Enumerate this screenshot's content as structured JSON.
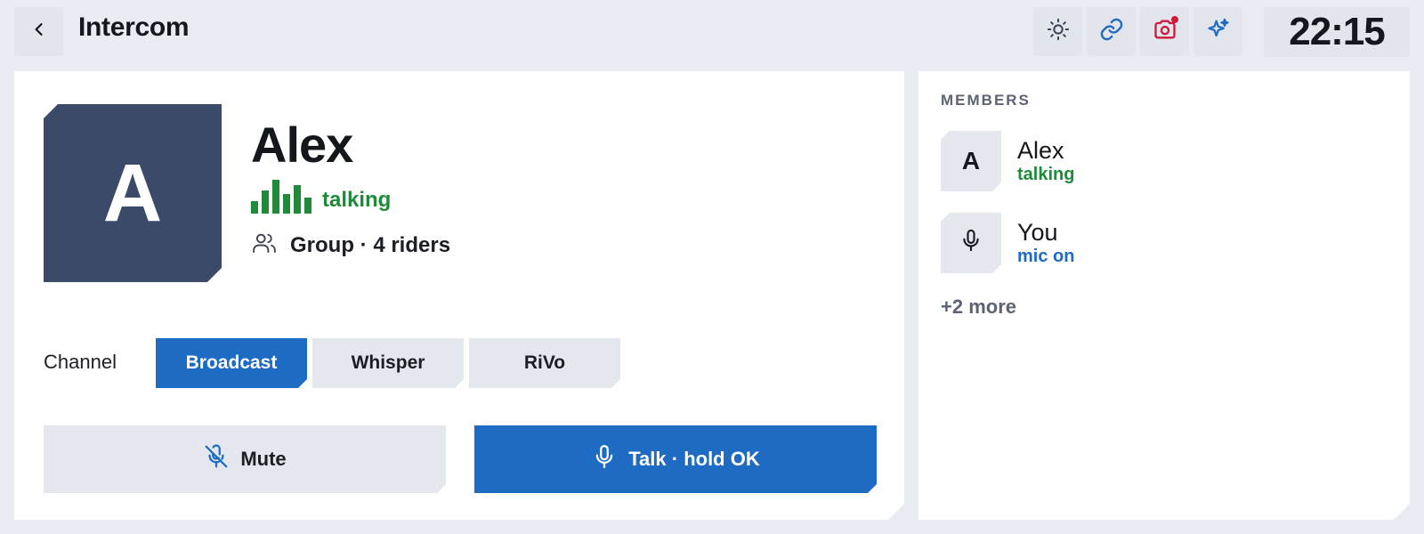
{
  "header": {
    "title": "Intercom",
    "back_icon": "chevron-left-icon",
    "icons": [
      "sun-icon",
      "link-icon",
      "camera-icon",
      "sparkle-icon"
    ],
    "clock": "22:15"
  },
  "contact": {
    "initial": "A",
    "name": "Alex",
    "status": "talking",
    "group": "Group · 4 riders"
  },
  "channel": {
    "label": "Channel",
    "options": [
      "Broadcast",
      "Whisper",
      "RiVo"
    ],
    "selected": "Broadcast"
  },
  "actions": {
    "mute_label": "Mute",
    "talk_label": "Talk · hold OK"
  },
  "members": {
    "title": "MEMBERS",
    "items": [
      {
        "initial": "A",
        "name": "Alex",
        "status": "talking"
      },
      {
        "initial": "",
        "name": "You",
        "status": "mic on"
      }
    ],
    "more": "+2 more"
  },
  "colors": {
    "accent": "#1e6bc4",
    "talking": "#1e8a3a",
    "record": "#d11a3b",
    "avatar": "#3a4a68",
    "background": "#e8ebf1"
  }
}
